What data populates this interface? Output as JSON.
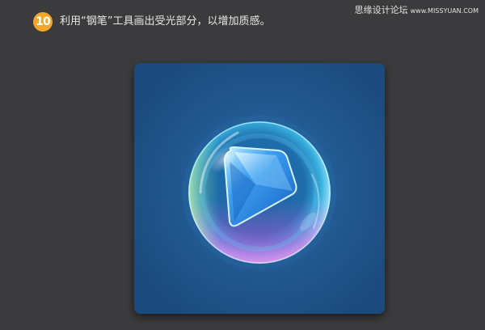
{
  "step": {
    "number": "10",
    "text": "利用“钢笔”工具画出受光部分，以增加质感。"
  },
  "watermark": {
    "site": "思缘设计论坛",
    "url": "www.MISSYUAN.COM"
  },
  "colors": {
    "background": "#3b3b3d",
    "badge": "#f3a62b",
    "canvas": "#1e4f82",
    "sphere_rim": "#8ee3ff",
    "sphere_bottom_glow": "#c04fd6",
    "play_shape": "#2f8fe6"
  },
  "artwork": {
    "icon": "glass-bubble-play-icon"
  }
}
